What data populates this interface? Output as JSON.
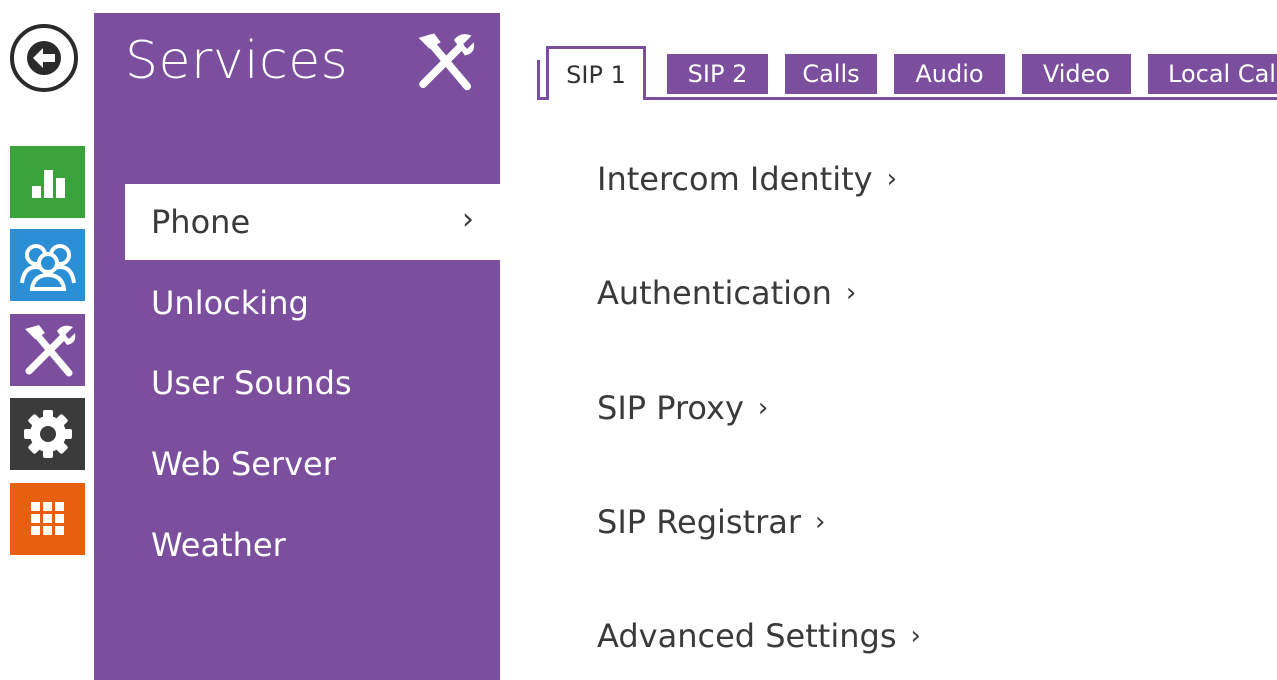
{
  "icons": {
    "back": "arrow-left-icon",
    "status": "bar-chart-icon",
    "directory": "users-icon",
    "services": "tools-icon",
    "settings": "gear-icon",
    "apps": "grid-icon"
  },
  "colors": {
    "purple": "#7b4f9e",
    "green": "#3aa33a",
    "blue": "#2b8fd6",
    "dark": "#3b3b3b",
    "orange": "#e8600f"
  },
  "section": {
    "title": "Services",
    "menu": [
      {
        "label": "Phone",
        "active": true
      },
      {
        "label": "Unlocking"
      },
      {
        "label": "User Sounds"
      },
      {
        "label": "Web Server"
      },
      {
        "label": "Weather"
      }
    ],
    "chevron": "›"
  },
  "tabs": [
    {
      "label": "SIP 1",
      "active": true
    },
    {
      "label": "SIP 2"
    },
    {
      "label": "Calls"
    },
    {
      "label": "Audio"
    },
    {
      "label": "Video"
    },
    {
      "label": "Local Calls"
    }
  ],
  "content": {
    "links": [
      {
        "label": "Intercom Identity"
      },
      {
        "label": "Authentication"
      },
      {
        "label": "SIP Proxy"
      },
      {
        "label": "SIP Registrar"
      },
      {
        "label": "Advanced Settings"
      }
    ],
    "chevron": "›"
  }
}
